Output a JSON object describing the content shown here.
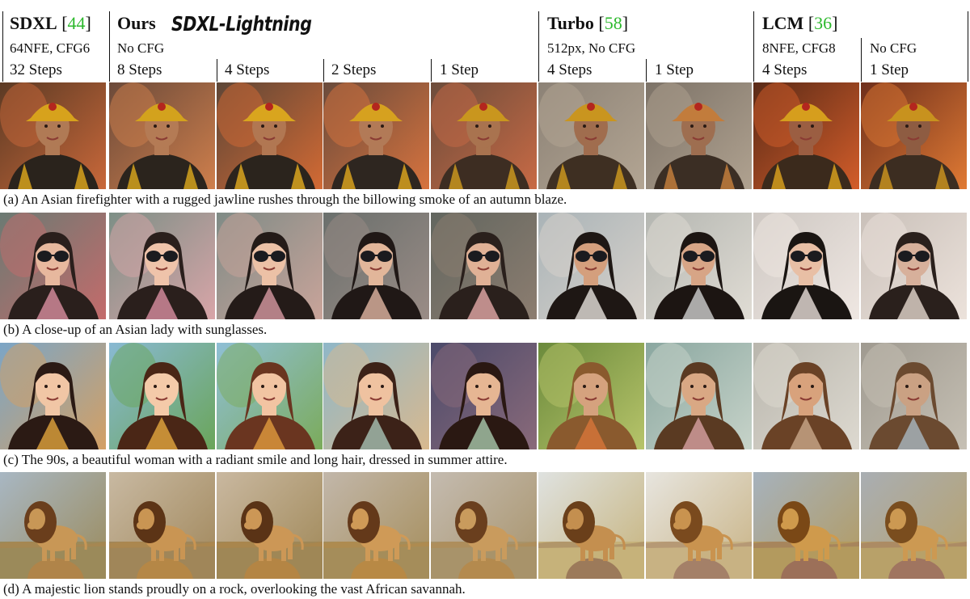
{
  "header": {
    "sdxl": {
      "name": "SDXL",
      "cite_open": " [",
      "cite": "44",
      "cite_close": "]",
      "setting": "64NFE, CFG6",
      "steps": "32 Steps"
    },
    "ours": {
      "name": "Ours",
      "brand": "SDXL-Lightning",
      "setting": "No CFG",
      "steps": [
        "8 Steps",
        "4 Steps",
        "2 Steps",
        "1 Step"
      ]
    },
    "turbo": {
      "name": "Turbo",
      "cite_open": " [",
      "cite": "58",
      "cite_close": "]",
      "setting": "512px, No CFG",
      "steps": [
        "4 Steps",
        "1 Step"
      ]
    },
    "lcm": {
      "name": "LCM",
      "cite_open": " [",
      "cite": "36",
      "cite_close": "]",
      "setting_a": "8NFE, CFG8",
      "setting_b": "No CFG",
      "steps": [
        "4 Steps",
        "1 Step"
      ]
    }
  },
  "colors": {
    "citation": "#2db92d",
    "rule": "#111111"
  },
  "rows": [
    {
      "subject": "firefighter",
      "caption": "(a) An Asian firefighter with a rugged jawline rushes through the billowing smoke of an autumn blaze.",
      "cells": [
        {
          "bg": "#5b3a24",
          "bg2": "#c9683a",
          "fg": "#2a231c",
          "acc": "#d7a21c",
          "skin": "#b07a55"
        },
        {
          "bg": "#6b4a3a",
          "bg2": "#cf7f4c",
          "fg": "#2b241d",
          "acc": "#d3a21d",
          "skin": "#b47b55"
        },
        {
          "bg": "#5d4637",
          "bg2": "#d36a34",
          "fg": "#2b241d",
          "acc": "#d9a51e",
          "skin": "#b17752"
        },
        {
          "bg": "#6a4b3c",
          "bg2": "#d7733e",
          "fg": "#2e2620",
          "acc": "#d6a11f",
          "skin": "#b27a57"
        },
        {
          "bg": "#6c4c3b",
          "bg2": "#c86a45",
          "fg": "#3d2d22",
          "acc": "#c9961e",
          "skin": "#a9734f"
        },
        {
          "bg": "#8c8276",
          "bg2": "#b3a593",
          "fg": "#3e2f22",
          "acc": "#c9951f",
          "skin": "#a06d4e"
        },
        {
          "bg": "#7d7368",
          "bg2": "#b0a290",
          "fg": "#3b2e24",
          "acc": "#c27c3c",
          "skin": "#9e6e50"
        },
        {
          "bg": "#5a2a17",
          "bg2": "#d35d2a",
          "fg": "#3b2a1c",
          "acc": "#d69e1d",
          "skin": "#9b5e42"
        },
        {
          "bg": "#6e2f1c",
          "bg2": "#e07a34",
          "fg": "#3c2d21",
          "acc": "#c8921e",
          "skin": "#8e5c42"
        }
      ]
    },
    {
      "subject": "lady-sunglasses",
      "caption": "(b) A close-up of an Asian lady with sunglasses.",
      "cells": [
        {
          "bg": "#6b7a73",
          "bg2": "#c46b6b",
          "fg": "#2a1f1c",
          "acc": "#d98ea0",
          "skin": "#e7b89e"
        },
        {
          "bg": "#7d8f86",
          "bg2": "#d8a5a8",
          "fg": "#2a1f1c",
          "acc": "#d98fa1",
          "skin": "#efc3aa"
        },
        {
          "bg": "#7f8b86",
          "bg2": "#c9a49a",
          "fg": "#241b18",
          "acc": "#d79aa3",
          "skin": "#ecc1a6"
        },
        {
          "bg": "#6a6f6c",
          "bg2": "#9a8c86",
          "fg": "#201816",
          "acc": "#e1b7a2",
          "skin": "#e2b69a"
        },
        {
          "bg": "#62665f",
          "bg2": "#8c7d70",
          "fg": "#2a201c",
          "acc": "#e3a9a8",
          "skin": "#e0b196"
        },
        {
          "bg": "#a9b3b7",
          "bg2": "#d8d2cb",
          "fg": "#1e1714",
          "acc": "#e6e2dc",
          "skin": "#d49f7d"
        },
        {
          "bg": "#b4b6b1",
          "bg2": "#e0dcd4",
          "fg": "#1c1512",
          "acc": "#cfcfd0",
          "skin": "#d7a586"
        },
        {
          "bg": "#cdc7c2",
          "bg2": "#efe7e2",
          "fg": "#1a1512",
          "acc": "#e8dfd9",
          "skin": "#e8bfa5"
        },
        {
          "bg": "#c9c0b9",
          "bg2": "#ece2db",
          "fg": "#2a201c",
          "acc": "#e5d8ce",
          "skin": "#d7b09b"
        }
      ]
    },
    {
      "subject": "woman-90s",
      "caption": "(c) The 90s, a beautiful woman with a radiant smile and long hair, dressed in summer attire.",
      "cells": [
        {
          "bg": "#7ba5c6",
          "bg2": "#d4a064",
          "fg": "#2b1a14",
          "acc": "#e1a43c",
          "skin": "#f1c6a5"
        },
        {
          "bg": "#89b9d3",
          "bg2": "#6aa55a",
          "fg": "#4a2616",
          "acc": "#e3a83e",
          "skin": "#f4caa9"
        },
        {
          "bg": "#8fbfd6",
          "bg2": "#7bab5b",
          "fg": "#6a3520",
          "acc": "#e19b3d",
          "skin": "#f2c4a2"
        },
        {
          "bg": "#8fb7c8",
          "bg2": "#d8b98f",
          "fg": "#3c2218",
          "acc": "#a8c3b5",
          "skin": "#efc2a0"
        },
        {
          "bg": "#4b4a6a",
          "bg2": "#8a6a7a",
          "fg": "#2a1812",
          "acc": "#a9c9ad",
          "skin": "#e6b693"
        },
        {
          "bg": "#6b8a3c",
          "bg2": "#b7c46a",
          "fg": "#8a5a2e",
          "acc": "#d7763a",
          "skin": "#d5a27e"
        },
        {
          "bg": "#8aa7a0",
          "bg2": "#c7d3c9",
          "fg": "#5a3a22",
          "acc": "#d7a1a3",
          "skin": "#d9a884"
        },
        {
          "bg": "#b9b6ad",
          "bg2": "#ddd9d0",
          "fg": "#6a4226",
          "acc": "#c9a88a",
          "skin": "#d8a27c"
        },
        {
          "bg": "#9f9a90",
          "bg2": "#c6c0b4",
          "fg": "#6b4a30",
          "acc": "#a9b7c1",
          "skin": "#caa183"
        }
      ]
    },
    {
      "subject": "lion",
      "caption": "(d) A majestic lion stands proudly on a rock, overlooking the vast African savannah.",
      "cells": [
        {
          "bg": "#a8b7c3",
          "bg2": "#9b8a5a",
          "fg": "#6a3e1c",
          "acc": "#b08449",
          "skin": "#c89756"
        },
        {
          "bg": "#c8b9a2",
          "bg2": "#a08659",
          "fg": "#5c3416",
          "acc": "#b58746",
          "skin": "#c99553"
        },
        {
          "bg": "#c9b8a0",
          "bg2": "#9f8756",
          "fg": "#5a3316",
          "acc": "#b48544",
          "skin": "#cc9756"
        },
        {
          "bg": "#c2b7aa",
          "bg2": "#a58d5a",
          "fg": "#64391a",
          "acc": "#b88945",
          "skin": "#cf9a57"
        },
        {
          "bg": "#c4bbb0",
          "bg2": "#a8936a",
          "fg": "#6a3f1e",
          "acc": "#b48a4e",
          "skin": "#c99b5d"
        },
        {
          "bg": "#dfe2e0",
          "bg2": "#c6b27a",
          "fg": "#6a3f1a",
          "acc": "#9c7a5a",
          "skin": "#c48f4f"
        },
        {
          "bg": "#e7e5df",
          "bg2": "#c8b283",
          "fg": "#7a4a1e",
          "acc": "#a48068",
          "skin": "#c9934f"
        },
        {
          "bg": "#a6b2bd",
          "bg2": "#b39a5e",
          "fg": "#7a4816",
          "acc": "#9c7059",
          "skin": "#cf9a4c"
        },
        {
          "bg": "#a9aeb3",
          "bg2": "#b8a169",
          "fg": "#7a4d1e",
          "acc": "#a07560",
          "skin": "#cc9952"
        }
      ]
    }
  ]
}
